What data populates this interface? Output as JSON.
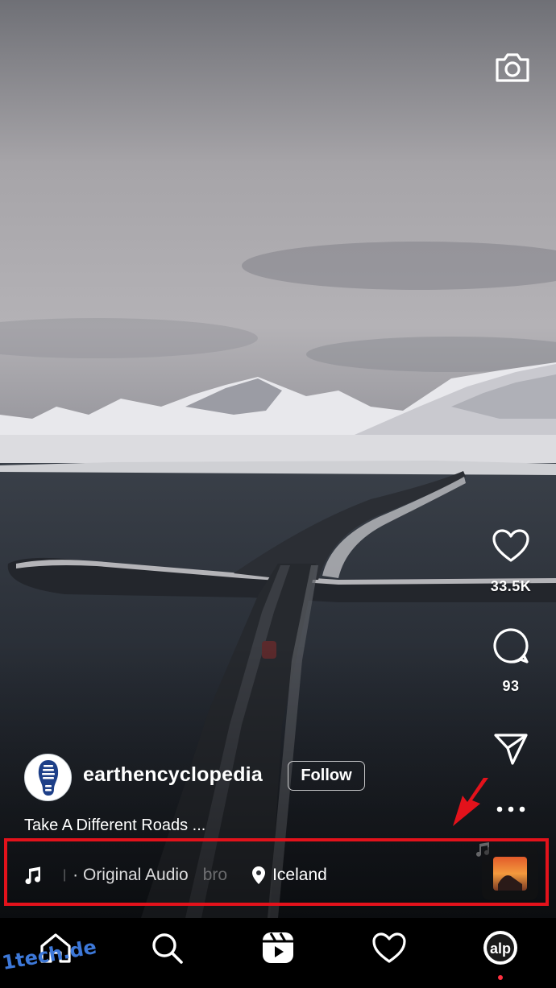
{
  "post": {
    "username": "earthencyclopedia",
    "follow_label": "Follow",
    "caption": "Take A Different Roads ...",
    "likes_count": "33.5K",
    "comments_count": "93"
  },
  "audio": {
    "label": "· Original Audio",
    "scroll_fragment": "bro",
    "location": "Iceland"
  },
  "icons": {
    "camera": "camera-icon",
    "like": "heart-outline-icon",
    "comment": "comment-bubble-icon",
    "share": "paper-plane-icon",
    "more": "ellipsis-icon",
    "music": "music-note-icon",
    "location": "location-pin-icon",
    "nav": [
      "home-icon",
      "search-icon",
      "reels-icon",
      "heart-icon",
      "profile-avatar"
    ]
  },
  "colors": {
    "highlight_box": "#e3121b",
    "annotation_arrow": "#e3121b",
    "notification_dot": "#ff3040",
    "watermark": "#3d78d8"
  },
  "watermark": "1tech.de"
}
